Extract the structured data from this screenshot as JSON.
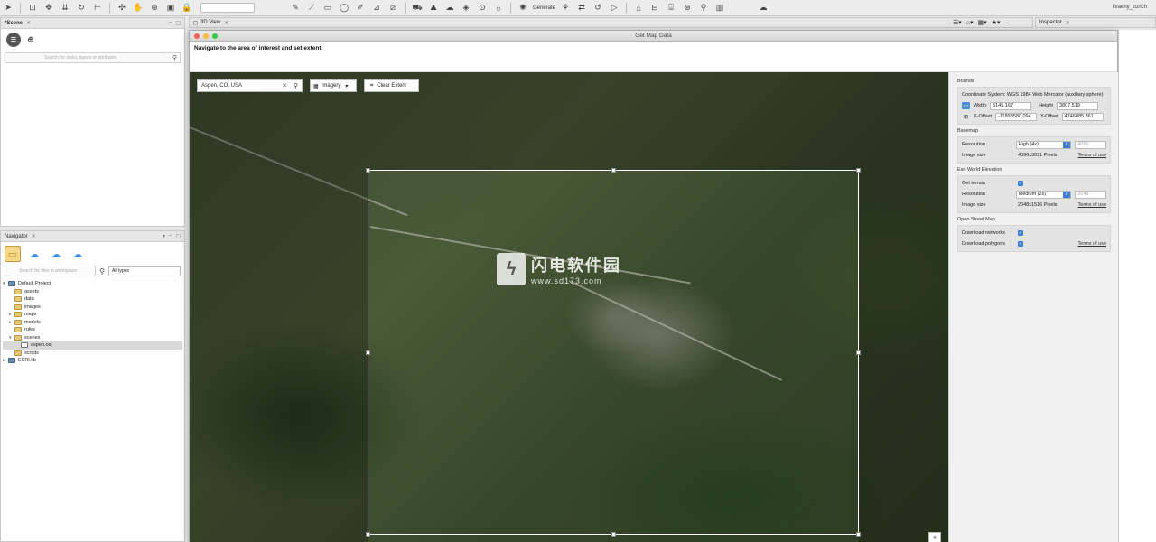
{
  "toolbar": {
    "generate_label": "Generate",
    "user": "tivaeny_zurich"
  },
  "scene_pane": {
    "tab_label": "*Scene",
    "search_placeholder": "Search for tasks, layers or attributes"
  },
  "navigator_pane": {
    "tab_label": "Navigator",
    "search_placeholder": "Search for files in workspace",
    "filter_value": "All types",
    "tree": [
      {
        "label": "Default Project",
        "level": 0,
        "type": "proj",
        "expanded": true
      },
      {
        "label": "assets",
        "level": 1,
        "type": "folder"
      },
      {
        "label": "data",
        "level": 1,
        "type": "folder"
      },
      {
        "label": "images",
        "level": 1,
        "type": "folder"
      },
      {
        "label": "maps",
        "level": 1,
        "type": "folder",
        "collapsed": true
      },
      {
        "label": "models",
        "level": 1,
        "type": "folder",
        "collapsed": true
      },
      {
        "label": "rules",
        "level": 1,
        "type": "folder"
      },
      {
        "label": "scenes",
        "level": 1,
        "type": "folder",
        "expanded": true
      },
      {
        "label": "aspen.cej",
        "level": 2,
        "type": "file",
        "selected": true
      },
      {
        "label": "scripts",
        "level": 1,
        "type": "folder"
      },
      {
        "label": "ESRI.lib",
        "level": 0,
        "type": "proj",
        "collapsed": true
      }
    ]
  },
  "view": {
    "tab_label": "3D View",
    "inspector_tab_label": "Inspector"
  },
  "dialog": {
    "title": "Get Map Data",
    "instruction": "Navigate to the area of interest and set extent.",
    "search_value": "Aspen, CO, USA",
    "basemap_select": "Imagery",
    "clear_extent_label": "Clear Extent",
    "watermark_cn": "闪电软件园",
    "watermark_url": "www.sd173.com"
  },
  "settings": {
    "bounds_title": "Bounds",
    "coord_system": "Coordinate System: WGS 1984 Web Mercator (auxiliary sphere)",
    "width_label": "Width",
    "width_value": "5145.167",
    "height_label": "Height",
    "height_value": "3807.519",
    "xoffset_label": "X-Offset",
    "xoffset_value": "-11893580.094",
    "yoffset_label": "Y-Offset",
    "yoffset_value": "4746885.361",
    "basemap_title": "Basemap",
    "resolution_label": "Resolution",
    "basemap_resolution": "High (4x)",
    "basemap_extra": "4096",
    "image_size_label": "Image size",
    "basemap_image_size": "4096x3031 Pixels",
    "terms_label": "Terms of use",
    "elevation_title": "Esri World Elevation",
    "get_terrain_label": "Get terrain",
    "elevation_resolution": "Medium (2x)",
    "elevation_extra": "2048",
    "elevation_image_size": "2048x1516 Pixels",
    "osm_title": "Open Street Map",
    "download_networks_label": "Download networks",
    "download_polygons_label": "Download polygons"
  }
}
